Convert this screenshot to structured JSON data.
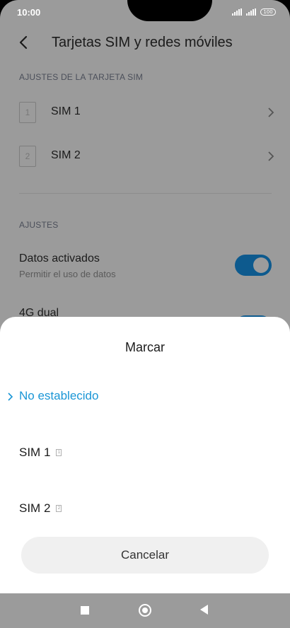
{
  "status": {
    "time": "10:00",
    "battery": "100"
  },
  "header": {
    "title": "Tarjetas SIM y redes móviles"
  },
  "sim_section": {
    "label": "AJUSTES DE LA TARJETA SIM",
    "items": [
      {
        "number": "1",
        "label": "SIM 1"
      },
      {
        "number": "2",
        "label": "SIM 2"
      }
    ]
  },
  "settings_section": {
    "label": "AJUSTES",
    "data_toggle": {
      "title": "Datos activados",
      "subtitle": "Permitir el uso de datos",
      "on": true
    },
    "dual_4g": {
      "title": "4G dual"
    }
  },
  "sheet": {
    "title": "Marcar",
    "options": [
      {
        "label": "No establecido",
        "selected": true,
        "sim": ""
      },
      {
        "label": "SIM 1",
        "selected": false,
        "sim": "1"
      },
      {
        "label": "SIM 2",
        "selected": false,
        "sim": "2"
      }
    ],
    "cancel_label": "Cancelar"
  },
  "colors": {
    "accent": "#1a96d6",
    "toggle_on": "#0d5a8e",
    "dim_background": "#9b9b9b"
  }
}
